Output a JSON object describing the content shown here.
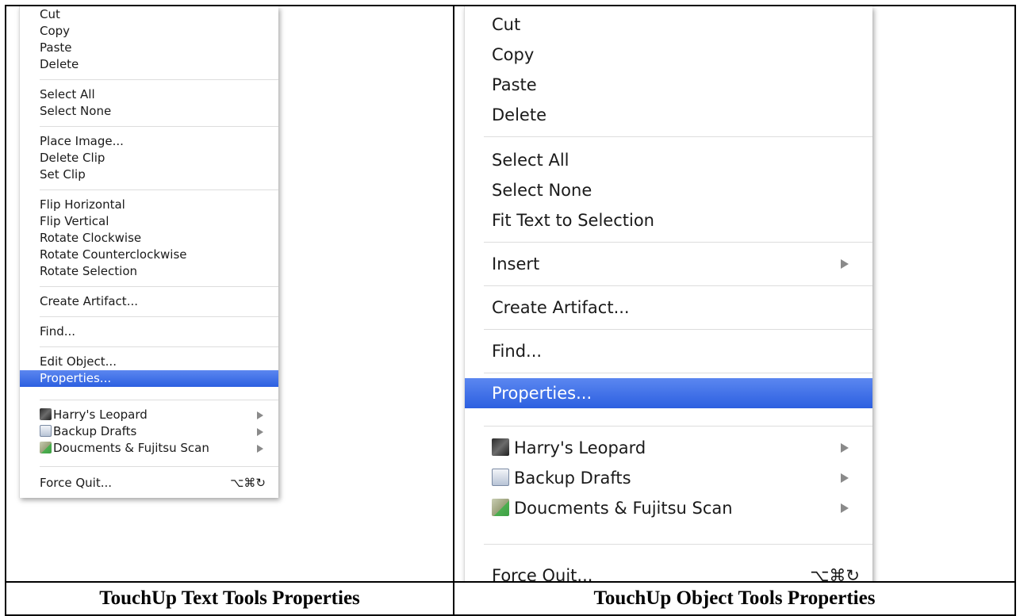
{
  "left_menu": {
    "cut": "Cut",
    "copy": "Copy",
    "paste": "Paste",
    "delete": "Delete",
    "select_all": "Select All",
    "select_none": "Select None",
    "place_image": "Place Image...",
    "delete_clip": "Delete Clip",
    "set_clip": "Set Clip",
    "flip_horizontal": "Flip Horizontal",
    "flip_vertical": "Flip Vertical",
    "rotate_clockwise": "Rotate Clockwise",
    "rotate_counterclockwise": "Rotate Counterclockwise",
    "rotate_selection": "Rotate Selection",
    "create_artifact": "Create Artifact...",
    "find": "Find...",
    "edit_object": "Edit Object...",
    "properties": "Properties...",
    "harrys_leopard": "Harry's Leopard",
    "backup_drafts": "Backup Drafts",
    "documents_scan": "Doucments & Fujitsu Scan",
    "force_quit": "Force Quit...",
    "force_quit_shortcut": "⌥⌘↻"
  },
  "right_menu": {
    "cut": "Cut",
    "copy": "Copy",
    "paste": "Paste",
    "delete": "Delete",
    "select_all": "Select All",
    "select_none": "Select None",
    "fit_text": "Fit Text to Selection",
    "insert": "Insert",
    "create_artifact": "Create Artifact...",
    "find": "Find...",
    "properties": "Properties...",
    "harrys_leopard": "Harry's Leopard",
    "backup_drafts": "Backup Drafts",
    "documents_scan": "Doucments & Fujitsu Scan",
    "force_quit": "Force Quit...",
    "force_quit_shortcut": "⌥⌘↻"
  },
  "captions": {
    "left": "TouchUp Text Tools Properties",
    "right": "TouchUp Object Tools Properties"
  },
  "colors": {
    "selection": "#3a6ce6"
  }
}
